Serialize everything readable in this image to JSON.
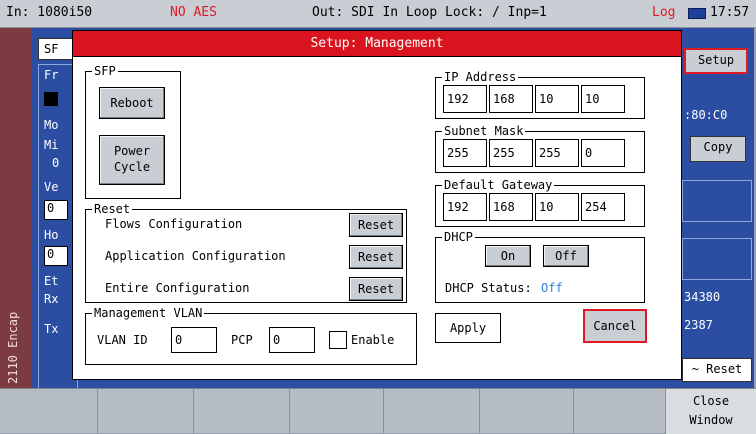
{
  "status_bar": {
    "format": "In: 1080i50",
    "alarm": "NO AES",
    "output": "Out: SDI In Loop  Lock: / Inp=1",
    "log": "Log",
    "time": "17:57"
  },
  "side_tab": {
    "label": "2110 Encap"
  },
  "background": {
    "tab_sf": "SF",
    "section_fr": "Fr",
    "mo": "Mo",
    "mi": "Mi",
    "zero": "0",
    "ve": "Ve",
    "field0": "0",
    "ho": "Ho",
    "field1": "0",
    "eth": "Et",
    "rx": "Rx",
    "tx": "Tx",
    "setup_button": "Setup",
    "mac_fragment": ":80:C0",
    "copy_button": "Copy",
    "value_a": "34380",
    "value_b": "2387",
    "reset_button": "~ Reset"
  },
  "dialog": {
    "title": "Setup: Management",
    "sfp": {
      "legend": "SFP",
      "reboot": "Reboot",
      "power_cycle_1": "Power",
      "power_cycle_2": "Cycle"
    },
    "reset": {
      "legend": "Reset",
      "rows": [
        {
          "label": "Flows Configuration",
          "button": "Reset"
        },
        {
          "label": "Application Configuration",
          "button": "Reset"
        },
        {
          "label": "Entire Configuration",
          "button": "Reset"
        }
      ]
    },
    "vlan": {
      "legend": "Management VLAN",
      "vlan_id_label": "VLAN ID",
      "vlan_id_value": "0",
      "pcp_label": "PCP",
      "pcp_value": "0",
      "enable_label": "Enable"
    },
    "ip": {
      "legend": "IP Address",
      "octets": [
        "192",
        "168",
        "10",
        "10"
      ]
    },
    "mask": {
      "legend": "Subnet Mask",
      "octets": [
        "255",
        "255",
        "255",
        "0"
      ]
    },
    "gateway": {
      "legend": "Default Gateway",
      "octets": [
        "192",
        "168",
        "10",
        "254"
      ]
    },
    "dhcp": {
      "legend": "DHCP",
      "on": "On",
      "off": "Off",
      "status_label": "DHCP Status:",
      "status_value": "Off",
      "status_color": "#2f7fd6"
    },
    "apply": "Apply",
    "cancel": "Cancel"
  },
  "softkeys": {
    "close_line1": "Close",
    "close_line2": "Window"
  },
  "colors": {
    "title_bar": "#d9141f",
    "highlight": "#e01a23",
    "panel_blue": "#2b4ea3"
  }
}
